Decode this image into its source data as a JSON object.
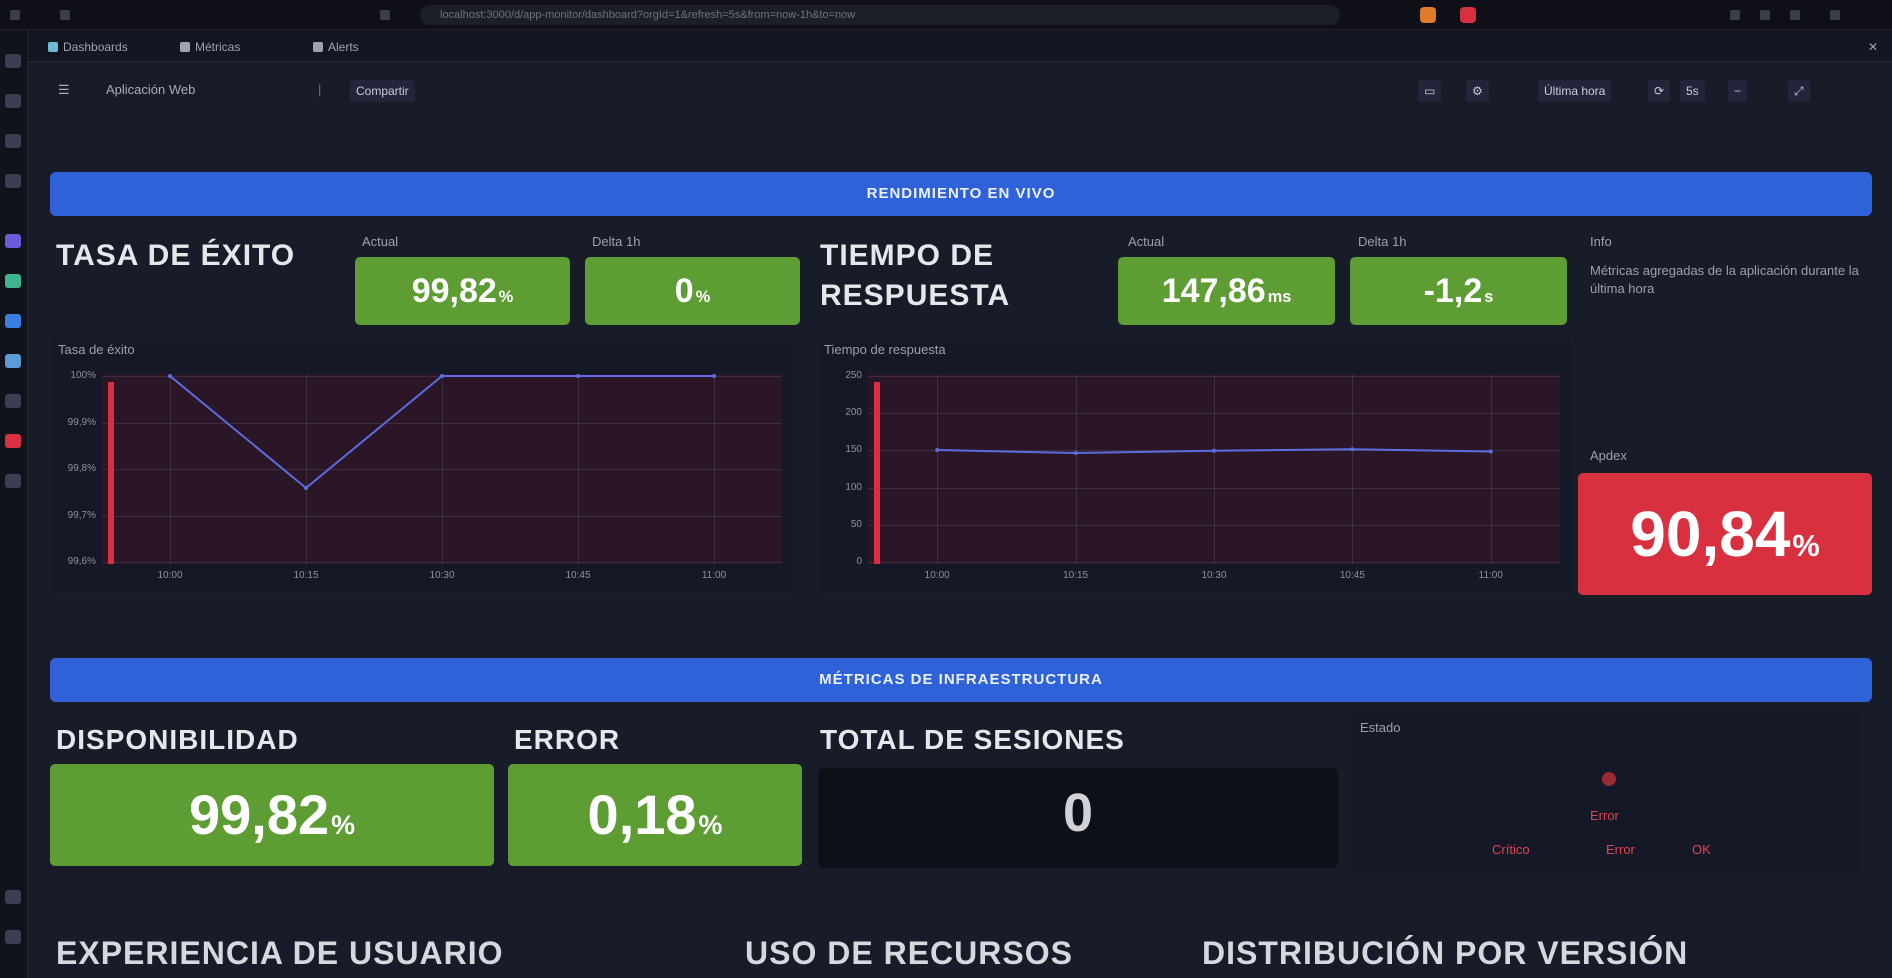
{
  "browser": {
    "url": "localhost:3000/d/app-monitor/dashboard?orgId=1&refresh=5s&from=now-1h&to=now"
  },
  "tabs": [
    {
      "label": "Dashboards"
    },
    {
      "label": "Métricas"
    },
    {
      "label": "Alerts"
    }
  ],
  "toolbar": {
    "breadcrumb": "Aplicación Web",
    "share_label": "Compartir",
    "time_range": "Última hora",
    "refresh_label": "5s",
    "zoom_out": "−"
  },
  "rows": {
    "performance": "RENDIMIENTO EN VIVO",
    "infrastructure": "MÉTRICAS DE INFRAESTRUCTURA"
  },
  "success": {
    "title": "TASA DE ÉXITO",
    "current_label": "Actual",
    "current_value": "99,82",
    "current_unit": "%",
    "delta_label": "Delta 1h",
    "delta_value": "0",
    "delta_unit": "%",
    "chart_title": "Tasa de éxito"
  },
  "response": {
    "title_line1": "TIEMPO DE",
    "title_line2": "RESPUESTA",
    "current_label": "Actual",
    "current_value": "147,86",
    "current_unit": "ms",
    "delta_label": "Delta 1h",
    "delta_value": "-1,2",
    "delta_unit": "s",
    "chart_title": "Tiempo de respuesta"
  },
  "side_note": {
    "label": "Info",
    "text": "Métricas agregadas de la aplicación durante la última hora"
  },
  "apdex": {
    "label": "Apdex",
    "value": "90,84",
    "unit": "%"
  },
  "availability": {
    "title": "DISPONIBILIDAD",
    "value": "99,82",
    "unit": "%"
  },
  "errors": {
    "title": "ERROR",
    "value": "0,18",
    "unit": "%"
  },
  "sessions": {
    "title": "TOTAL DE SESIONES",
    "value": "0"
  },
  "status_panel": {
    "label": "Estado",
    "legend": [
      "Crítico",
      "Error",
      "OK"
    ]
  },
  "bottom_sections": {
    "ux": "EXPERIENCIA DE USUARIO",
    "resources": "USO DE RECURSOS",
    "versions": "DISTRIBUCIÓN POR VERSIÓN"
  },
  "chart_data": [
    {
      "type": "line",
      "title": "Tasa de éxito",
      "x": [
        "10:00",
        "10:15",
        "10:30",
        "10:45",
        "11:00"
      ],
      "ylim": [
        99.5,
        100
      ],
      "y_ticks": [
        "100%",
        "99,9%",
        "99,8%",
        "99,7%",
        "99,6%"
      ],
      "series": [
        {
          "values": [
            100,
            99.7,
            100,
            100,
            100
          ]
        }
      ],
      "grid": true
    },
    {
      "type": "line",
      "title": "Tiempo de respuesta",
      "x": [
        "10:00",
        "10:15",
        "10:30",
        "10:45",
        "11:00"
      ],
      "ylim": [
        0,
        250
      ],
      "y_ticks": [
        "250",
        "200",
        "150",
        "100",
        "50",
        "0"
      ],
      "series": [
        {
          "values": [
            150,
            146,
            149,
            151,
            148
          ]
        }
      ],
      "grid": true
    }
  ],
  "colors": {
    "green": "#5d9d33",
    "red": "#d9303f",
    "blue": "#2f62d8"
  }
}
